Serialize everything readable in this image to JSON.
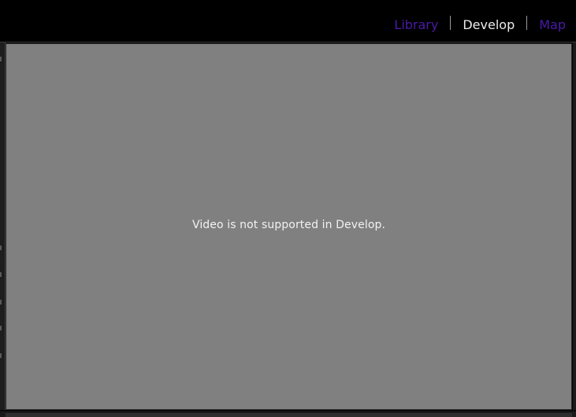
{
  "module_picker": {
    "items": [
      {
        "label": "Library",
        "state": "inactive"
      },
      {
        "label": "Develop",
        "state": "active"
      },
      {
        "label": "Map",
        "state": "inactive"
      }
    ],
    "colors": {
      "inactive": "#4a1aa8",
      "active": "#ececec"
    }
  },
  "preview": {
    "message": "Video is not supported in Develop.",
    "background": "#808080"
  }
}
